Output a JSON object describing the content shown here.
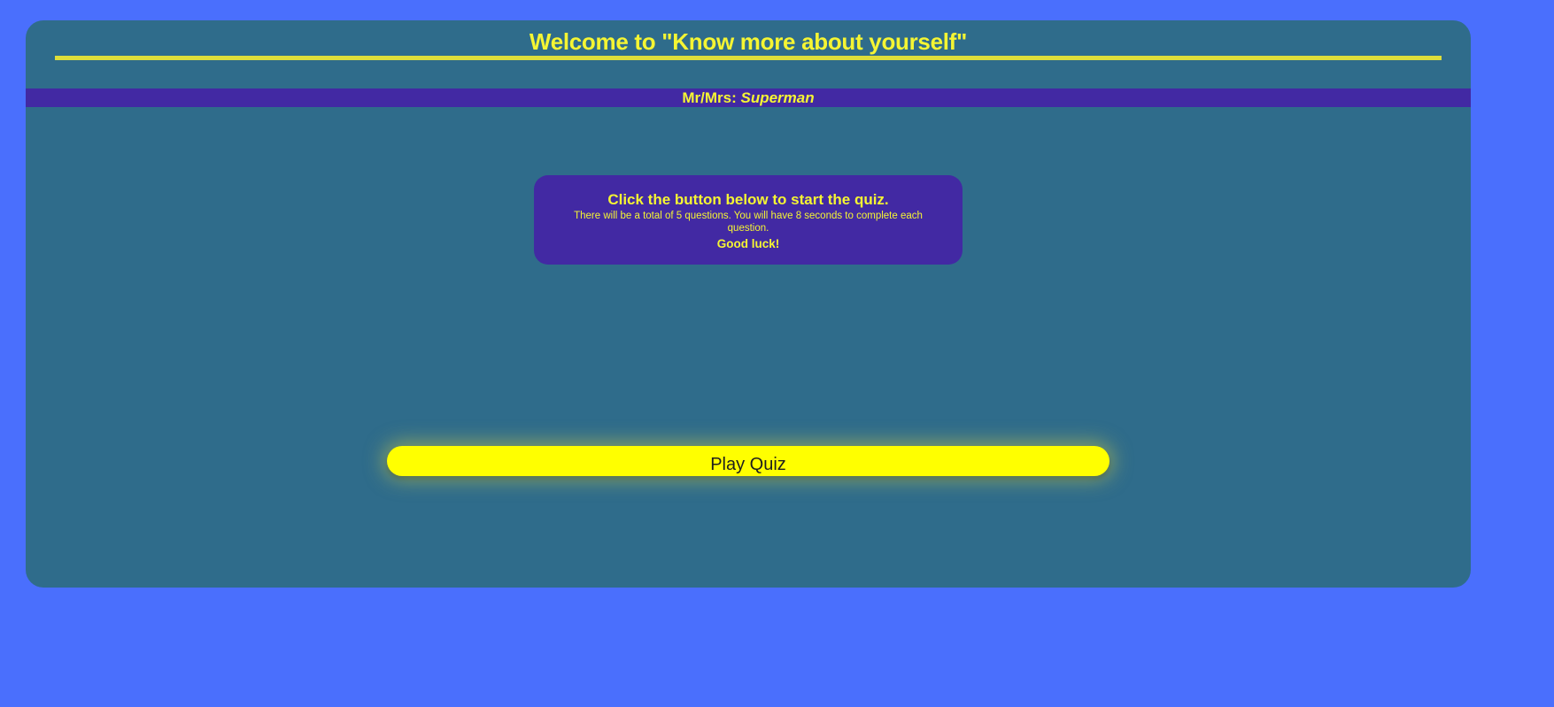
{
  "header": {
    "title": "Welcome to \"Know more about yourself\""
  },
  "user": {
    "prefix": "Mr/Mrs: ",
    "name": "Superman"
  },
  "info": {
    "heading": "Click the button below to start the quiz.",
    "text": "There will be a total of 5 questions. You will have 8 seconds to complete each question.",
    "closing": "Good luck!"
  },
  "actions": {
    "play_label": "Play Quiz"
  },
  "colors": {
    "page_background": "#4a6ffd",
    "card_background": "#2f6c8b",
    "accent_text": "#f5f533",
    "panel_background": "#4229a3",
    "button_background": "#ffff00"
  }
}
